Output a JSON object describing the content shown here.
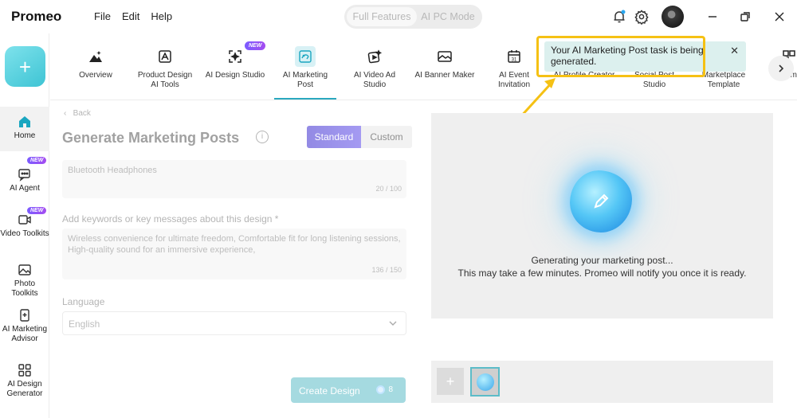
{
  "app": {
    "name": "Promeo"
  },
  "menu": [
    "File",
    "Edit",
    "Help"
  ],
  "mode": {
    "active": "Full Features",
    "other": "AI PC Mode"
  },
  "sidebar": {
    "create_symbol": "+",
    "items": [
      {
        "label": "Home",
        "icon": "home-icon"
      },
      {
        "label": "AI Agent",
        "icon": "ai-agent-icon",
        "badge": "NEW"
      },
      {
        "label": "Video Toolkits",
        "icon": "video-icon",
        "badge": "NEW"
      },
      {
        "label": "Photo Toolkits",
        "icon": "photo-icon"
      },
      {
        "label": "AI Marketing Advisor",
        "icon": "advisor-icon"
      },
      {
        "label": "AI Design Generator",
        "icon": "grid-icon"
      }
    ]
  },
  "tools": [
    {
      "label": "Overview",
      "icon": "overview-icon"
    },
    {
      "label": "Product Design AI Tools",
      "icon": "product-design-icon"
    },
    {
      "label": "AI Design Studio",
      "icon": "design-studio-icon",
      "badge": "NEW"
    },
    {
      "label": "AI Marketing Post",
      "icon": "marketing-post-icon",
      "active": true
    },
    {
      "label": "AI Video Ad Studio",
      "icon": "video-ad-icon"
    },
    {
      "label": "AI Banner Maker",
      "icon": "banner-icon"
    },
    {
      "label": "AI Event Invitation",
      "icon": "calendar-icon"
    },
    {
      "label": "AI Profile Creator",
      "icon": "profile-icon"
    },
    {
      "label": "Social Post Studio",
      "icon": "social-icon"
    },
    {
      "label": "Marketplace Template",
      "icon": "marketplace-icon"
    },
    {
      "label": "Tem",
      "icon": "template-icon"
    }
  ],
  "notification": {
    "text": "Your AI Marketing Post task is being generated."
  },
  "form": {
    "back": "Back",
    "title": "Generate Marketing Posts",
    "info": "i",
    "segments": {
      "standard": "Standard",
      "custom": "Custom"
    },
    "product_value": "Bluetooth Headphones",
    "product_counter": "20 / 100",
    "keywords_label": "Add keywords or key messages about this design *",
    "keywords_value": "Wireless convenience for ultimate freedom, Comfortable fit for long listening sessions, High-quality sound for an immersive experience,",
    "keywords_counter": "136 / 150",
    "language_label": "Language",
    "language_value": "English",
    "create_label": "Create Design",
    "credits": "8"
  },
  "preview": {
    "line1": "Generating your marketing post...",
    "line2": "This may take a few minutes. Promeo will notify you once it is ready."
  },
  "colors": {
    "accent": "#2aa8bf",
    "highlight": "#f5c114",
    "standard": "#3b2ccf",
    "notification_bg": "#dcf0ee"
  }
}
